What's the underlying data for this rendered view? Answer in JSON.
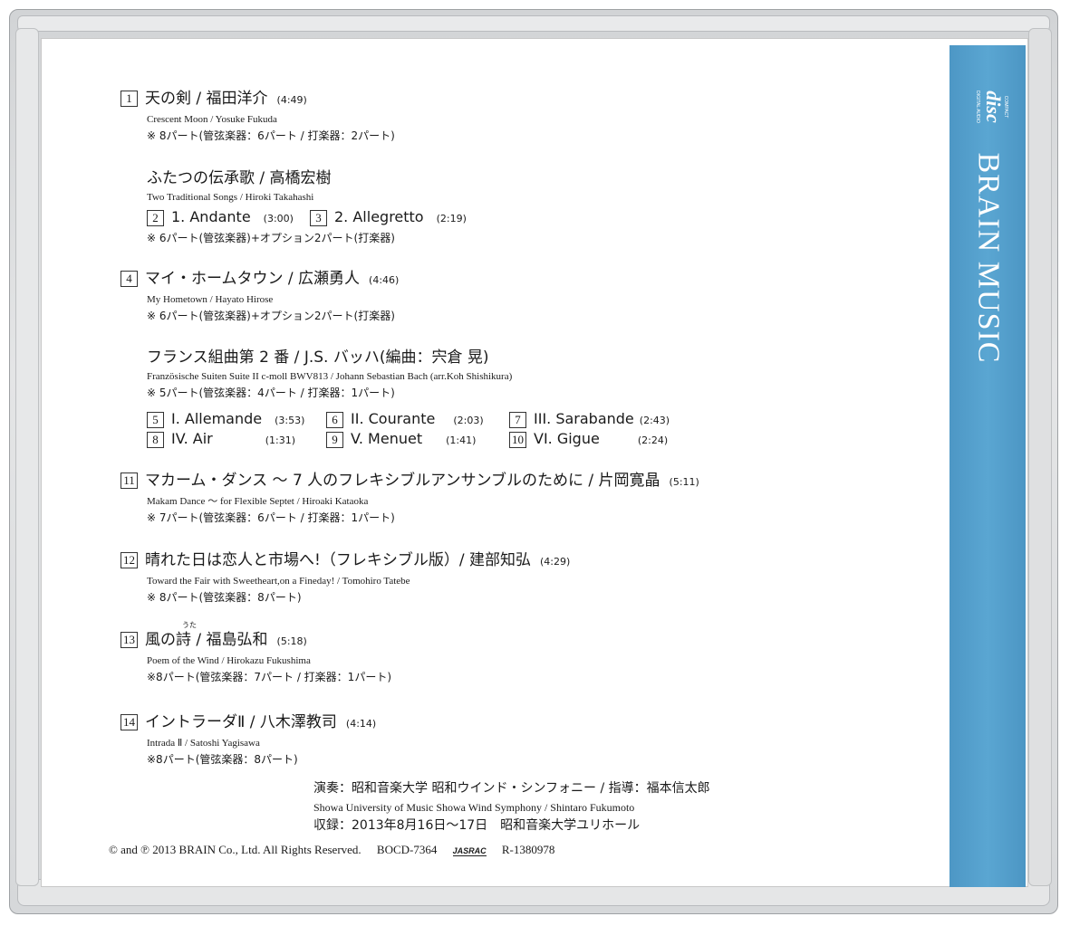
{
  "spine": {
    "cd_logo_top": "COMPACT",
    "cd_logo_main": "disc",
    "cd_logo_bottom": "DIGITAL AUDIO",
    "brand": "BRAIN MUSIC",
    "color": "#5aa6d2"
  },
  "tracks": {
    "t1": {
      "num": "1",
      "title": "天の剣 / 福田洋介",
      "duration": "(4:49)",
      "english": "Crescent Moon / Yosuke Fukuda",
      "note": "※ 8パート(管弦楽器：6パート / 打楽器：2パート)"
    },
    "t2_3": {
      "title": "ふたつの伝承歌 / 高橋宏樹",
      "english": "Two Traditional Songs / Hiroki Takahashi",
      "note": "※ 6パート(管弦楽器)+オプション2パート(打楽器)",
      "movements": [
        {
          "num": "2",
          "label": "1. Andante",
          "duration": "(3:00)"
        },
        {
          "num": "3",
          "label": "2. Allegretto",
          "duration": "(2:19)"
        }
      ]
    },
    "t4": {
      "num": "4",
      "title": "マイ・ホームタウン / 広瀬勇人",
      "duration": "(4:46)",
      "english": "My Hometown / Hayato Hirose",
      "note": "※ 6パート(管弦楽器)+オプション2パート(打楽器)"
    },
    "t5_10": {
      "title": "フランス組曲第 2 番 / J.S. バッハ(編曲：宍倉 晃)",
      "english": "Französische Suiten  Suite II c-moll BWV813 / Johann Sebastian Bach (arr.Koh Shishikura)",
      "note": "※ 5パート(管弦楽器：4パート / 打楽器：1パート)",
      "movements": [
        {
          "num": "5",
          "label": "I. Allemande",
          "duration": "(3:53)"
        },
        {
          "num": "6",
          "label": "II. Courante",
          "duration": "(2:03)"
        },
        {
          "num": "7",
          "label": "III. Sarabande",
          "duration": "(2:43)"
        },
        {
          "num": "8",
          "label": "IV. Air",
          "duration": "(1:31)"
        },
        {
          "num": "9",
          "label": "V. Menuet",
          "duration": "(1:41)"
        },
        {
          "num": "10",
          "label": "VI. Gigue",
          "duration": "(2:24)"
        }
      ]
    },
    "t11": {
      "num": "11",
      "title": "マカーム・ダンス ～ 7 人のフレキシブルアンサンブルのために / 片岡寛晶",
      "duration": "(5:11)",
      "english": "Makam Dance ～ for Flexible Septet / Hiroaki Kataoka",
      "note": "※ 7パート(管弦楽器：6パート / 打楽器：1パート)"
    },
    "t12": {
      "num": "12",
      "title": "晴れた日は恋人と市場へ!（フレキシブル版）/ 建部知弘",
      "duration": "(4:29)",
      "english": "Toward the Fair with Sweetheart,on a Fineday! / Tomohiro Tatebe",
      "note": "※ 8パート(管弦楽器：8パート)"
    },
    "t13": {
      "num": "13",
      "title": "風の詩 / 福島弘和",
      "ruby": "うた",
      "duration": "(5:18)",
      "english": "Poem of the Wind / Hirokazu Fukushima",
      "note": "※8パート(管弦楽器：7パート / 打楽器：1パート)"
    },
    "t14": {
      "num": "14",
      "title": "イントラーダⅡ / 八木澤教司",
      "duration": "(4:14)",
      "english": "Intrada Ⅱ / Satoshi Yagisawa",
      "note": "※8パート(管弦楽器：8パート)"
    }
  },
  "credits": {
    "performer_jp": "演奏：昭和音楽大学 昭和ウインド・シンフォニー / 指導：福本信太郎",
    "performer_en": "Showa University of Music  Showa Wind Symphony / Shintaro Fukumoto",
    "recording": "収録：2013年8月16日～17日　昭和音楽大学ユリホール"
  },
  "footer": {
    "copyright": "© and ℗ 2013 BRAIN Co., Ltd. All Rights Reserved.",
    "catalog": "BOCD-7364",
    "jasrac": "JASRAC",
    "rights_code": "R-1380978"
  }
}
